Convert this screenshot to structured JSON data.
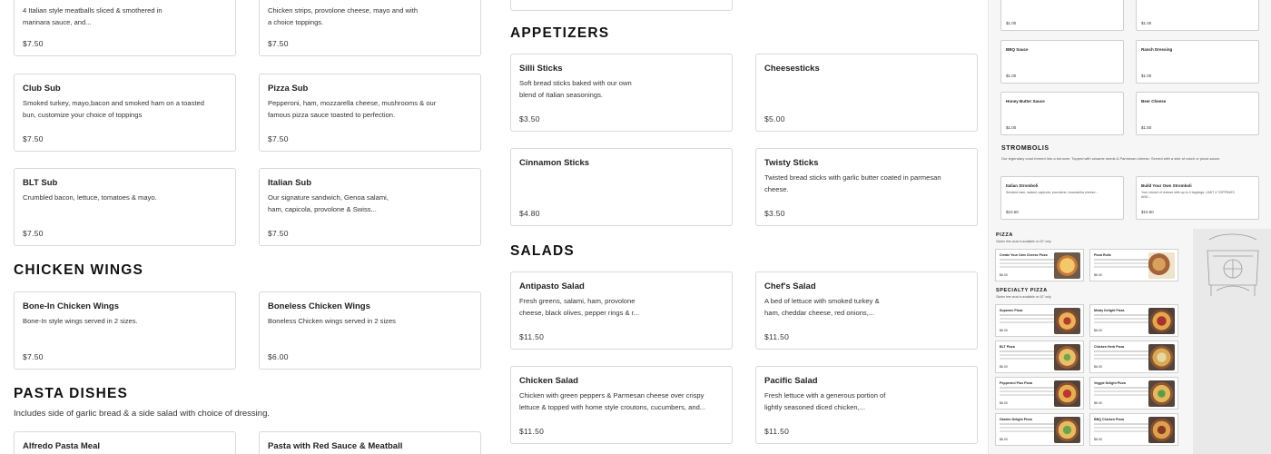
{
  "subs": [
    {
      "title": "",
      "desc": "4 Italian style meatballs sliced & smothered in marinara sauce, and...",
      "price": "$7.50"
    },
    {
      "title": "",
      "desc": "Chicken strips, provolone cheese, mayo and with a choice toppings.",
      "price": "$7.50"
    },
    {
      "title": "Club Sub",
      "desc": "Smoked turkey, mayo,bacon and smoked ham on a toasted bun, customize your choice of toppings",
      "price": "$7.50"
    },
    {
      "title": "Pizza Sub",
      "desc": "Pepperoni, ham, mozzarella cheese, mushrooms & our famous pizza sauce toasted to perfection.",
      "price": "$7.50"
    },
    {
      "title": "BLT Sub",
      "desc": "Crumbled bacon, lettuce, tomatoes & mayo.",
      "price": "$7.50"
    },
    {
      "title": "Italian Sub",
      "desc": "Our signature sandwich, Genoa salami, ham, capicola, provolone & Swiss...",
      "price": "$7.50"
    }
  ],
  "wings": {
    "heading": "Chicken Wings",
    "items": [
      {
        "title": "Bone-In Chicken Wings",
        "desc": "Bone-In style wings served in 2 sizes.",
        "price": "$7.50"
      },
      {
        "title": "Boneless Chicken Wings",
        "desc": "Boneless Chicken wings served in 2 sizes",
        "price": "$6.00"
      }
    ]
  },
  "pasta": {
    "heading": "Pasta Dishes",
    "subtitle": "Includes side of garlic bread & a side salad with choice of dressing.",
    "items": [
      {
        "title": "Alfredo Pasta Meal"
      },
      {
        "title": "Pasta with Red Sauce & Meatball"
      }
    ]
  },
  "appetizers": {
    "heading": "Appetizers",
    "items": [
      {
        "title": "Silli Sticks",
        "desc": "Soft bread sticks baked with our own blend of Italian seasonings.",
        "price": "$3.50"
      },
      {
        "title": "Cheesesticks",
        "desc": "",
        "price": "$5.00"
      },
      {
        "title": "Cinnamon Sticks",
        "desc": "",
        "price": "$4.80"
      },
      {
        "title": "Twisty Sticks",
        "desc": "Twisted bread sticks with garlic butter coated in parmesan cheese.",
        "price": "$3.50"
      }
    ]
  },
  "salads": {
    "heading": "Salads",
    "items": [
      {
        "title": "Antipasto Salad",
        "desc": "Fresh greens, salami, ham, provolone cheese, black olives, pepper rings & r...",
        "price": "$11.50"
      },
      {
        "title": "Chef's Salad",
        "desc": "A bed of lettuce with smoked turkey & ham, cheddar cheese, red onions,...",
        "price": "$11.50"
      },
      {
        "title": "Chicken Salad",
        "desc": "Chicken with green peppers & Parmesan cheese over crispy lettuce & topped with home style croutons, cucumbers, and...",
        "price": "$11.50"
      },
      {
        "title": "Pacific Salad",
        "desc": "Fresh lettuce with a generous portion of lightly seasoned diced chicken,...",
        "price": "$11.50"
      }
    ]
  },
  "preview": {
    "sauces": [
      {
        "name": "",
        "price": "$1.00"
      },
      {
        "name": "",
        "price": "$1.00"
      },
      {
        "name": "BBQ Sauce",
        "price": "$1.00"
      },
      {
        "name": "Ranch Dressing",
        "price": "$1.00"
      },
      {
        "name": "Honey Butter Sauce",
        "price": "$1.00"
      },
      {
        "name": "Beer Cheese",
        "price": "$1.50"
      }
    ],
    "stromboli_heading": "STROMBOLIS",
    "stromboli_desc": "Our legendary crust formed into a turnover. Topped with sesame seeds & Parmesan cheese. Served with a side of ranch or pizza sauce.",
    "stromboli_items": [
      {
        "name": "Italian Stromboli",
        "desc": "Smoked ham, salami, capicola, provolone, mozzarella cheese...",
        "price": "$10.50"
      },
      {
        "name": "Build Your Own Stromboli",
        "desc": "Your choice of cheese with up to 4 toppings. LIMIT 4 TOPPINGS AND...",
        "price": "$10.50"
      }
    ],
    "pizza_heading": "PIZZA",
    "pizza_note": "Gluten free crust is available on 10\" only.",
    "pizza_items": [
      {
        "name": "Create Your Own Cheese Pizza",
        "price": "$6.00"
      },
      {
        "name": "Pizza Rolls",
        "price": "$6.00"
      }
    ],
    "specialty_heading": "SPECIALTY PIZZA",
    "specialty_note": "Gluten free crust is available on 10\" only.",
    "specialty_items": [
      {
        "name": "Supreme Pizza",
        "price": "$6.00"
      },
      {
        "name": "Meaty Delight Pizza",
        "price": "$6.00"
      },
      {
        "name": "BLT Pizza",
        "price": "$6.00"
      },
      {
        "name": "Chicken Herb Pizza",
        "price": "$6.00"
      },
      {
        "name": "Pepperoni Plus Pizza",
        "price": "$6.00"
      },
      {
        "name": "Veggie Delight Pizza",
        "price": "$6.00"
      },
      {
        "name": "Garden Delight Pizza",
        "price": "$6.00"
      },
      {
        "name": "BBQ Chicken Pizza",
        "price": "$6.00"
      }
    ]
  },
  "colors": {
    "card_border": "#d9d9d9",
    "text": "#222222",
    "panel_bg": "#f6f6f6"
  }
}
